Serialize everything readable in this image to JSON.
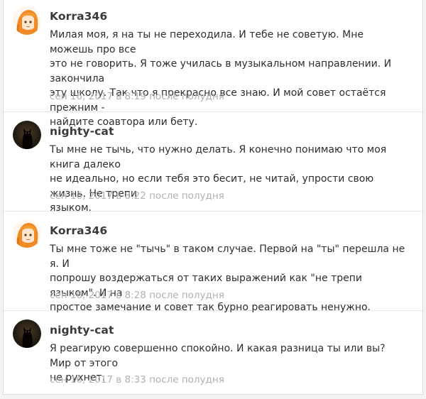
{
  "comments": [
    {
      "author": "Korra346",
      "avatar": "anime-girl-orange-hair-icon",
      "lines": [
        "Милая моя, я на ты не переходила. И тебе не советую. Мне можешь про все",
        "это не говорить. Я тоже училась в музыкальном направлении. И закончила",
        "эту школу. Так что я прекрасно все знаю. И мой совет остаётся прежним -",
        "найдите соавтора или бету."
      ],
      "date": "сен 16, 2017 в 8:19 после полудня"
    },
    {
      "author": "nighty-cat",
      "avatar": "black-cat-icon",
      "lines": [
        "Ты мне не тычь, что нужно делать. Я конечно понимаю что моя книга далеко",
        "не идеально, но если тебя это бесит, не читай, упрости свою жизнь. Не трепи",
        "языком."
      ],
      "date": "сен 16, 2017 в 8:22 после полудня"
    },
    {
      "author": "Korra346",
      "avatar": "anime-girl-orange-hair-icon",
      "lines": [
        "Ты мне тоже не \"тычь\" в таком случае. Первой на \"ты\" перешла не я. И",
        "попрошу воздержаться от таких выражений как \"не трепи языком\". И на",
        "простое замечание и совет так бурно реагировать ненужно."
      ],
      "date": "сен 16, 2017 в 8:28 после полудня"
    },
    {
      "author": "nighty-cat",
      "avatar": "black-cat-icon",
      "lines": [
        "Я реагирую совершенно спокойно. И какая разница ты или вы? Мир от этого",
        "не рухнет."
      ],
      "date": "сен 16, 2017 в 8:33 после полудня"
    }
  ]
}
